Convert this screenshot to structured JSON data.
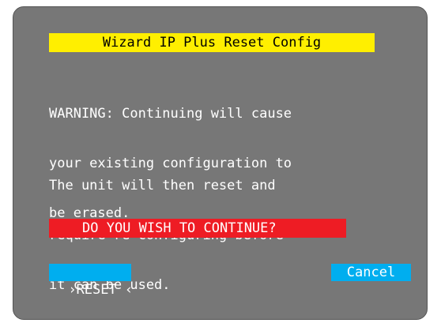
{
  "dialog": {
    "title": "Wizard IP Plus Reset Config",
    "warning_lines": [
      "WARNING: Continuing will cause",
      "your existing configuration to",
      "be erased."
    ],
    "info_lines": [
      "The unit will then reset and",
      "require re-configuring before",
      "it can be used."
    ],
    "prompt": "DO YOU WISH TO CONTINUE?",
    "reset_label": "RESET",
    "reset_left_marker": "›",
    "reset_right_marker": "‹",
    "cancel_label": "Cancel"
  },
  "colors": {
    "panel": "#777777",
    "title_bg": "#ffef00",
    "prompt_bg": "#ee1c24",
    "button_bg": "#00aeef",
    "text": "#ffffff"
  }
}
